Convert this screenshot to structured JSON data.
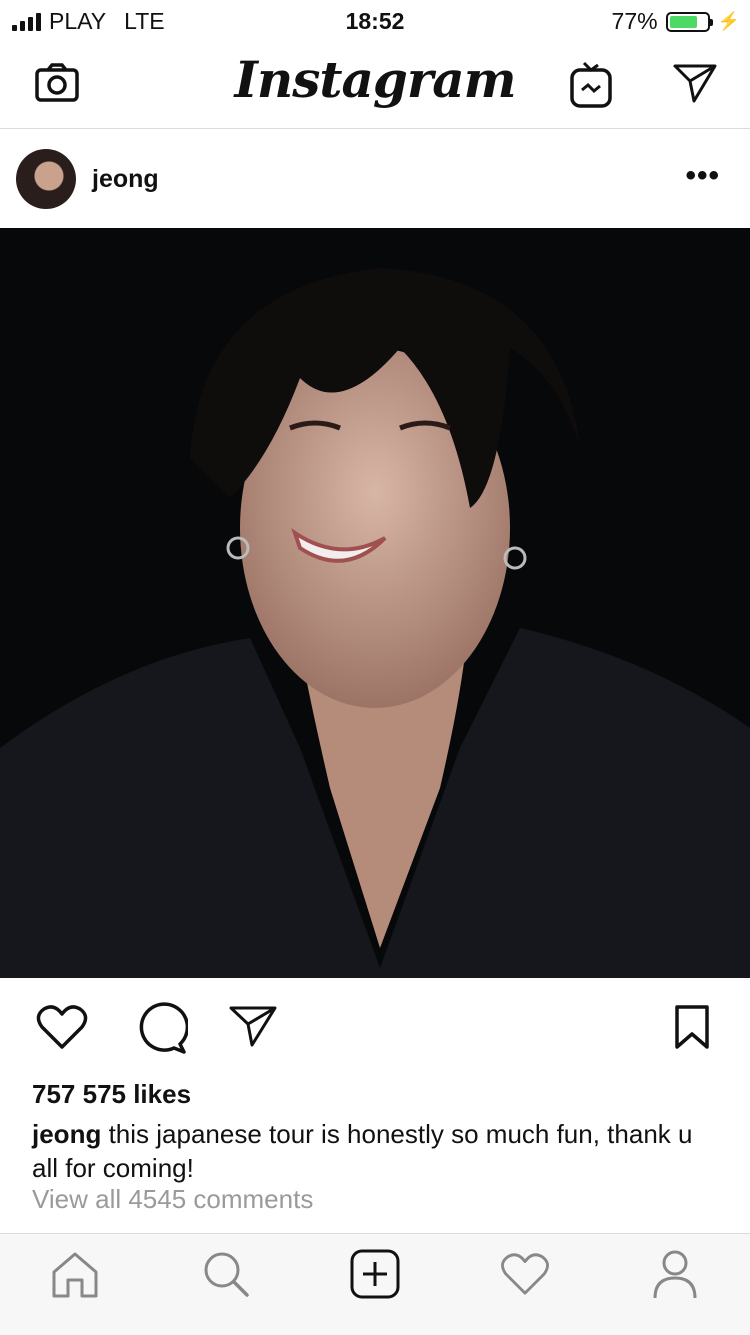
{
  "status": {
    "carrier": "PLAY",
    "network": "LTE",
    "time": "18:52",
    "battery": "77%",
    "battery_level": 0.77
  },
  "header": {
    "logo": "Instagram",
    "icons": [
      "camera-icon",
      "igtv-icon",
      "direct-message-icon"
    ]
  },
  "post": {
    "username": "jeong",
    "more": "•••",
    "likes": "757 575 likes",
    "caption_user": "jeong",
    "caption_text": " this japanese tour is honestly so much fun, thank u all for coming!",
    "comments": "View all 4545 comments",
    "actions": [
      "heart-icon",
      "comment-icon",
      "share-icon",
      "bookmark-icon"
    ]
  },
  "tabbar": {
    "items": [
      "home-icon",
      "search-icon",
      "add-post-icon",
      "activity-heart-icon",
      "profile-icon"
    ]
  },
  "colors": {
    "battery_green": "#4cd964",
    "separator": "#dbdbdb",
    "muted_text": "#9a9a9a"
  }
}
